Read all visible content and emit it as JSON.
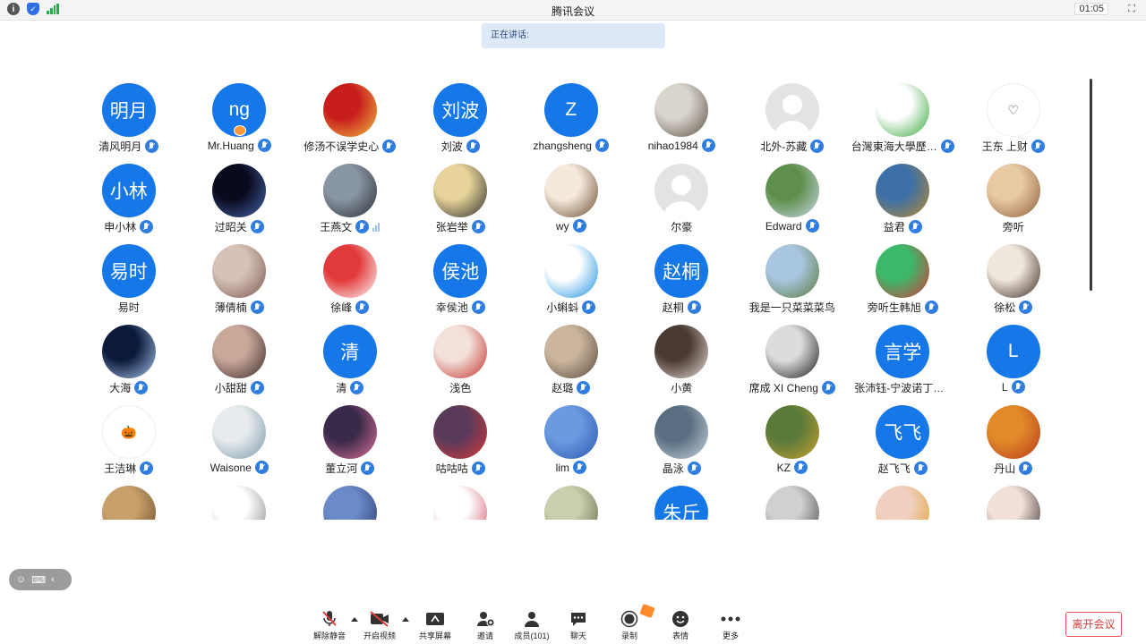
{
  "titlebar": {
    "title": "腾讯会议",
    "time": "01:05"
  },
  "speaking": {
    "label": "正在讲话:"
  },
  "participants": [
    {
      "name": "清风明月",
      "initials": "明月",
      "kind": "blue"
    },
    {
      "name": "Mr.Huang",
      "initials": "ng",
      "kind": "blue",
      "host": true
    },
    {
      "name": "修汤不误学史心",
      "kind": "photo",
      "c1": "#c81d1d",
      "c2": "#f0c040"
    },
    {
      "name": "刘波",
      "initials": "刘波",
      "kind": "blue"
    },
    {
      "name": "zhangsheng",
      "initials": "Z",
      "kind": "blue"
    },
    {
      "name": "nihao1984",
      "kind": "photo",
      "c1": "#d9d4cc",
      "c2": "#5a5248"
    },
    {
      "name": "北外-苏藏",
      "kind": "gray"
    },
    {
      "name": "台灣東海大學歷…",
      "kind": "photo",
      "c1": "#ffffff",
      "c2": "#37a53a"
    },
    {
      "name": "王东 上财",
      "initials": "♡",
      "kind": "white"
    },
    {
      "name": "申小林",
      "initials": "小林",
      "kind": "blue"
    },
    {
      "name": "过昭关",
      "kind": "photo",
      "c1": "#0a0a1e",
      "c2": "#4466aa"
    },
    {
      "name": "王燕文",
      "kind": "photo",
      "c1": "#8895a3",
      "c2": "#2b2f35",
      "vol": true
    },
    {
      "name": "张岩举",
      "kind": "photo",
      "c1": "#e8d49a",
      "c2": "#2c2c2c"
    },
    {
      "name": "wy",
      "kind": "photo",
      "c1": "#f5e9dc",
      "c2": "#6b4a2e"
    },
    {
      "name": "尔豪",
      "kind": "gray",
      "nomic": true
    },
    {
      "name": "Edward",
      "kind": "photo",
      "c1": "#5f8f4c",
      "c2": "#c9d8e8"
    },
    {
      "name": "益君",
      "kind": "photo",
      "c1": "#3d6fa8",
      "c2": "#b68a2d"
    },
    {
      "name": "旁听",
      "kind": "photo",
      "c1": "#e8c9a4",
      "c2": "#8b5e3a",
      "nomic": true
    },
    {
      "name": "易时",
      "initials": "易时",
      "kind": "blue",
      "nomic": true
    },
    {
      "name": "薄倩楠",
      "kind": "photo",
      "c1": "#d6c2b6",
      "c2": "#7a5850"
    },
    {
      "name": "徐峰",
      "kind": "photo",
      "c1": "#e23a3a",
      "c2": "#ffffff"
    },
    {
      "name": "幸侯池",
      "initials": "侯池",
      "kind": "blue"
    },
    {
      "name": "小蝌蚪",
      "kind": "photo",
      "c1": "#ffffff",
      "c2": "#1a90e0"
    },
    {
      "name": "赵桐",
      "initials": "赵桐",
      "kind": "blue"
    },
    {
      "name": "我是一只菜菜菜鸟",
      "kind": "photo",
      "c1": "#a9c6e0",
      "c2": "#5a7a3a",
      "nomic": true
    },
    {
      "name": "旁听生韩旭",
      "kind": "photo",
      "c1": "#3cb86a",
      "c2": "#d43a3a"
    },
    {
      "name": "徐松",
      "kind": "photo",
      "c1": "#efe6dc",
      "c2": "#3a2a22"
    },
    {
      "name": "大海",
      "kind": "photo",
      "c1": "#0b1a3a",
      "c2": "#aac8f0"
    },
    {
      "name": "小甜甜",
      "kind": "photo",
      "c1": "#c9a89a",
      "c2": "#3a2a2a"
    },
    {
      "name": "清",
      "initials": "清",
      "kind": "blue"
    },
    {
      "name": "浅色",
      "kind": "photo",
      "c1": "#f4e0da",
      "c2": "#c0302a",
      "nomic": true
    },
    {
      "name": "赵璐",
      "kind": "photo",
      "c1": "#cbb59e",
      "c2": "#5a4a3c"
    },
    {
      "name": "小黄",
      "kind": "photo",
      "c1": "#4a3a34",
      "c2": "#e8ded6",
      "nomic": true
    },
    {
      "name": "席成 XI Cheng",
      "kind": "photo",
      "c1": "#dcdcdc",
      "c2": "#1a1a1a"
    },
    {
      "name": "张沛钰-宁波诺丁汉…",
      "initials": "言学",
      "kind": "blue",
      "nomic": true
    },
    {
      "name": "L",
      "initials": "L",
      "kind": "blue"
    },
    {
      "name": "王洁琳",
      "initials": "🎃",
      "kind": "white"
    },
    {
      "name": "Waisone",
      "kind": "photo",
      "c1": "#e6ecee",
      "c2": "#7c98a8"
    },
    {
      "name": "董立河",
      "kind": "photo",
      "c1": "#3a2a4a",
      "c2": "#e0709a"
    },
    {
      "name": "咕咕咕",
      "kind": "photo",
      "c1": "#5a3a5a",
      "c2": "#d63a3a"
    },
    {
      "name": "lim",
      "kind": "photo",
      "c1": "#6a9ae0",
      "c2": "#2a5ab0"
    },
    {
      "name": "晶泳",
      "kind": "photo",
      "c1": "#5a6e82",
      "c2": "#c8d4dc"
    },
    {
      "name": "KZ",
      "kind": "photo",
      "c1": "#5a7a3a",
      "c2": "#c8a030"
    },
    {
      "name": "赵飞飞",
      "initials": "飞飞",
      "kind": "blue"
    },
    {
      "name": "丹山",
      "kind": "photo",
      "c1": "#e08a2a",
      "c2": "#b83a1a"
    },
    {
      "name": "",
      "kind": "photo",
      "c1": "#c8a06a",
      "c2": "#6a4a2a"
    },
    {
      "name": "",
      "kind": "photo",
      "c1": "#ffffff",
      "c2": "#888888"
    },
    {
      "name": "",
      "kind": "photo",
      "c1": "#6a8ac8",
      "c2": "#2a3a6a"
    },
    {
      "name": "",
      "kind": "photo",
      "c1": "#ffffff",
      "c2": "#d05a6a"
    },
    {
      "name": "",
      "kind": "photo",
      "c1": "#c8d0b0",
      "c2": "#6a6a4a"
    },
    {
      "name": "",
      "initials": "朱斤",
      "kind": "blue"
    },
    {
      "name": "",
      "kind": "photo",
      "c1": "#d0d0d0",
      "c2": "#4a4a4a"
    },
    {
      "name": "",
      "kind": "photo",
      "c1": "#f0d0c0",
      "c2": "#e0a030"
    },
    {
      "name": "",
      "kind": "photo",
      "c1": "#f0e0d8",
      "c2": "#3a2a2a"
    }
  ],
  "toolbar": {
    "unmute": "解除静音",
    "start_video": "开启视频",
    "share_screen": "共享屏幕",
    "invite": "邀请",
    "members": "成员(101)",
    "chat": "聊天",
    "record": "录制",
    "emoji": "表情",
    "more": "更多",
    "leave": "离开会议"
  },
  "colors": {
    "accent": "#1677e8",
    "leave": "#d23c3c",
    "speaking_bg": "#dde9f8"
  }
}
